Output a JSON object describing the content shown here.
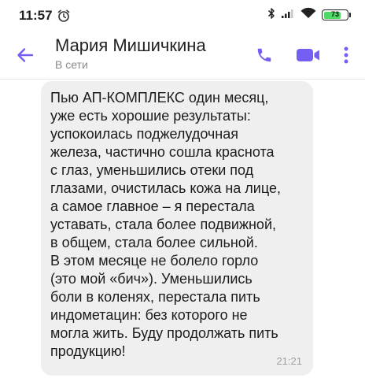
{
  "status_bar": {
    "time": "11:57",
    "battery": "73",
    "battery_level": 0.73
  },
  "header": {
    "contact_name": "Мария Мишичкина",
    "contact_status": "В сети"
  },
  "icons": {
    "back": "arrow-left-icon",
    "call": "phone-icon",
    "video": "video-camera-icon",
    "menu": "kebab-menu-icon",
    "alarm": "alarm-clock-icon",
    "bluetooth": "bluetooth-icon",
    "signal": "signal-icon",
    "wifi": "wifi-icon"
  },
  "colors": {
    "accent": "#7360f2",
    "bubble": "#efefef",
    "battery": "#4cd964"
  },
  "message": {
    "text": "Пью АП-КОМПЛЕКС один месяц,\nуже есть хорошие результаты:\nуспокоилась поджелудочная\nжелеза, частично сошла краснота\nс глаз, уменьшились отеки под\nглазами, очистилась кожа на лице,\nа самое главное – я перестала\nуставать, стала более подвижной,\nв общем, стала более сильной.\nВ этом месяце не болело горло\n(это мой «бич»). Уменьшились\nболи в коленях, перестала пить\nиндометацин: без которого не\nмогла жить. Буду продолжать пить\nпродукцию!",
    "time": "21:21"
  }
}
